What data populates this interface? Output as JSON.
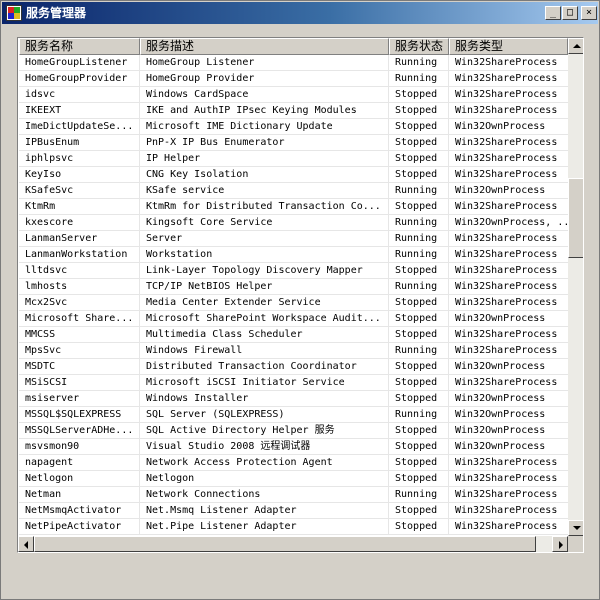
{
  "window": {
    "title": "服务管理器",
    "buttons": {
      "minimize": "_",
      "maximize": "□",
      "close": "×"
    }
  },
  "list": {
    "columns": [
      "服务名称",
      "服务描述",
      "服务状态",
      "服务类型"
    ],
    "rows": [
      [
        "HomeGroupListener",
        "HomeGroup Listener",
        "Running",
        "Win32ShareProcess"
      ],
      [
        "HomeGroupProvider",
        "HomeGroup Provider",
        "Running",
        "Win32ShareProcess"
      ],
      [
        "idsvc",
        "Windows CardSpace",
        "Stopped",
        "Win32ShareProcess"
      ],
      [
        "IKEEXT",
        "IKE and AuthIP IPsec Keying Modules",
        "Stopped",
        "Win32ShareProcess"
      ],
      [
        "ImeDictUpdateSe...",
        "Microsoft IME Dictionary Update",
        "Stopped",
        "Win32OwnProcess"
      ],
      [
        "IPBusEnum",
        "PnP-X IP Bus Enumerator",
        "Stopped",
        "Win32ShareProcess"
      ],
      [
        "iphlpsvc",
        "IP Helper",
        "Stopped",
        "Win32ShareProcess"
      ],
      [
        "KeyIso",
        "CNG Key Isolation",
        "Stopped",
        "Win32ShareProcess"
      ],
      [
        "KSafeSvc",
        "KSafe service",
        "Running",
        "Win32OwnProcess"
      ],
      [
        "KtmRm",
        "KtmRm for Distributed Transaction Co...",
        "Stopped",
        "Win32ShareProcess"
      ],
      [
        "kxescore",
        "Kingsoft Core Service",
        "Running",
        "Win32OwnProcess, ..."
      ],
      [
        "LanmanServer",
        "Server",
        "Running",
        "Win32ShareProcess"
      ],
      [
        "LanmanWorkstation",
        "Workstation",
        "Running",
        "Win32ShareProcess"
      ],
      [
        "lltdsvc",
        "Link-Layer Topology Discovery Mapper",
        "Stopped",
        "Win32ShareProcess"
      ],
      [
        "lmhosts",
        "TCP/IP NetBIOS Helper",
        "Running",
        "Win32ShareProcess"
      ],
      [
        "Mcx2Svc",
        "Media Center Extender Service",
        "Stopped",
        "Win32ShareProcess"
      ],
      [
        "Microsoft Share...",
        "Microsoft SharePoint Workspace Audit...",
        "Stopped",
        "Win32OwnProcess"
      ],
      [
        "MMCSS",
        "Multimedia Class Scheduler",
        "Stopped",
        "Win32ShareProcess"
      ],
      [
        "MpsSvc",
        "Windows Firewall",
        "Running",
        "Win32ShareProcess"
      ],
      [
        "MSDTC",
        "Distributed Transaction Coordinator",
        "Stopped",
        "Win32OwnProcess"
      ],
      [
        "MSiSCSI",
        "Microsoft iSCSI Initiator Service",
        "Stopped",
        "Win32ShareProcess"
      ],
      [
        "msiserver",
        "Windows Installer",
        "Stopped",
        "Win32OwnProcess"
      ],
      [
        "MSSQL$SQLEXPRESS",
        "SQL Server (SQLEXPRESS)",
        "Running",
        "Win32OwnProcess"
      ],
      [
        "MSSQLServerADHe...",
        "SQL Active Directory Helper 服务",
        "Stopped",
        "Win32OwnProcess"
      ],
      [
        "msvsmon90",
        "Visual Studio 2008 远程调试器",
        "Stopped",
        "Win32OwnProcess"
      ],
      [
        "napagent",
        "Network Access Protection Agent",
        "Stopped",
        "Win32ShareProcess"
      ],
      [
        "Netlogon",
        "Netlogon",
        "Stopped",
        "Win32ShareProcess"
      ],
      [
        "Netman",
        "Network Connections",
        "Running",
        "Win32ShareProcess"
      ],
      [
        "NetMsmqActivator",
        "Net.Msmq Listener Adapter",
        "Stopped",
        "Win32ShareProcess"
      ],
      [
        "NetPipeActivator",
        "Net.Pipe Listener Adapter",
        "Stopped",
        "Win32ShareProcess"
      ]
    ]
  }
}
